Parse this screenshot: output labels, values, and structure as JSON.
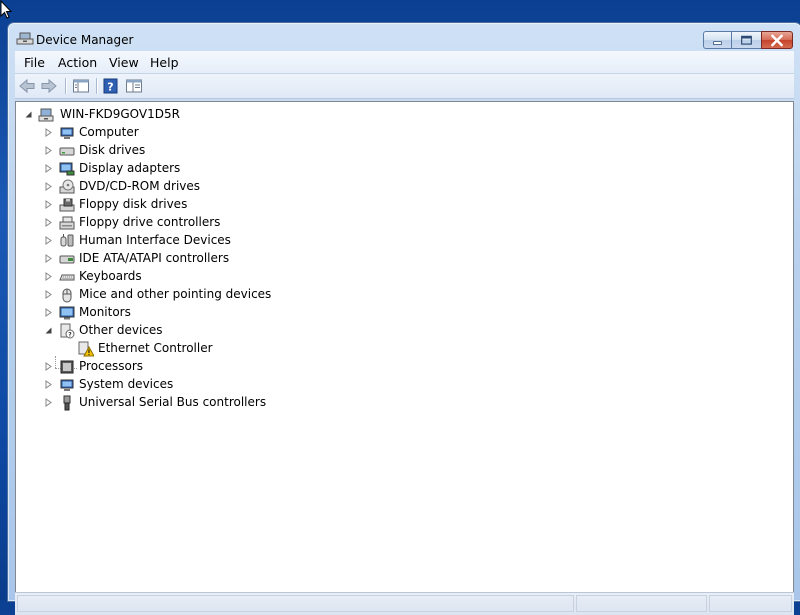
{
  "window": {
    "title": "Device Manager"
  },
  "menu": [
    {
      "label": "File"
    },
    {
      "label": "Action"
    },
    {
      "label": "View"
    },
    {
      "label": "Help"
    }
  ],
  "toolbar": [
    {
      "name": "back-arrow-icon"
    },
    {
      "name": "forward-arrow-icon"
    },
    {
      "name": "show-hide-console-tree-icon"
    },
    {
      "name": "help-icon"
    },
    {
      "name": "properties-icon"
    }
  ],
  "tree": {
    "root": {
      "label": "WIN-FKD9GOV1D5R",
      "icon": "computer-icon",
      "expanded": true
    },
    "categories": [
      {
        "label": "Computer",
        "icon": "computer-icon",
        "expanded": false
      },
      {
        "label": "Disk drives",
        "icon": "disk-drive-icon",
        "expanded": false
      },
      {
        "label": "Display adapters",
        "icon": "display-adapter-icon",
        "expanded": false
      },
      {
        "label": "DVD/CD-ROM drives",
        "icon": "optical-drive-icon",
        "expanded": false
      },
      {
        "label": "Floppy disk drives",
        "icon": "floppy-disk-icon",
        "expanded": false
      },
      {
        "label": "Floppy drive controllers",
        "icon": "floppy-controller-icon",
        "expanded": false
      },
      {
        "label": "Human Interface Devices",
        "icon": "hid-icon",
        "expanded": false
      },
      {
        "label": "IDE ATA/ATAPI controllers",
        "icon": "ide-controller-icon",
        "expanded": false
      },
      {
        "label": "Keyboards",
        "icon": "keyboard-icon",
        "expanded": false
      },
      {
        "label": "Mice and other pointing devices",
        "icon": "mouse-icon",
        "expanded": false
      },
      {
        "label": "Monitors",
        "icon": "monitor-icon",
        "expanded": false
      },
      {
        "label": "Other devices",
        "icon": "unknown-device-icon",
        "expanded": true,
        "children": [
          {
            "label": "Ethernet Controller",
            "icon": "warning-device-icon"
          }
        ]
      },
      {
        "label": "Processors",
        "icon": "processor-icon",
        "expanded": false
      },
      {
        "label": "System devices",
        "icon": "system-device-icon",
        "expanded": false
      },
      {
        "label": "Universal Serial Bus controllers",
        "icon": "usb-icon",
        "expanded": false
      }
    ]
  },
  "colors": {
    "desktop": "#1a5ab6",
    "window_frame": "#b9d1ee",
    "close_button": "#c4432b",
    "warning": "#f5c400"
  }
}
